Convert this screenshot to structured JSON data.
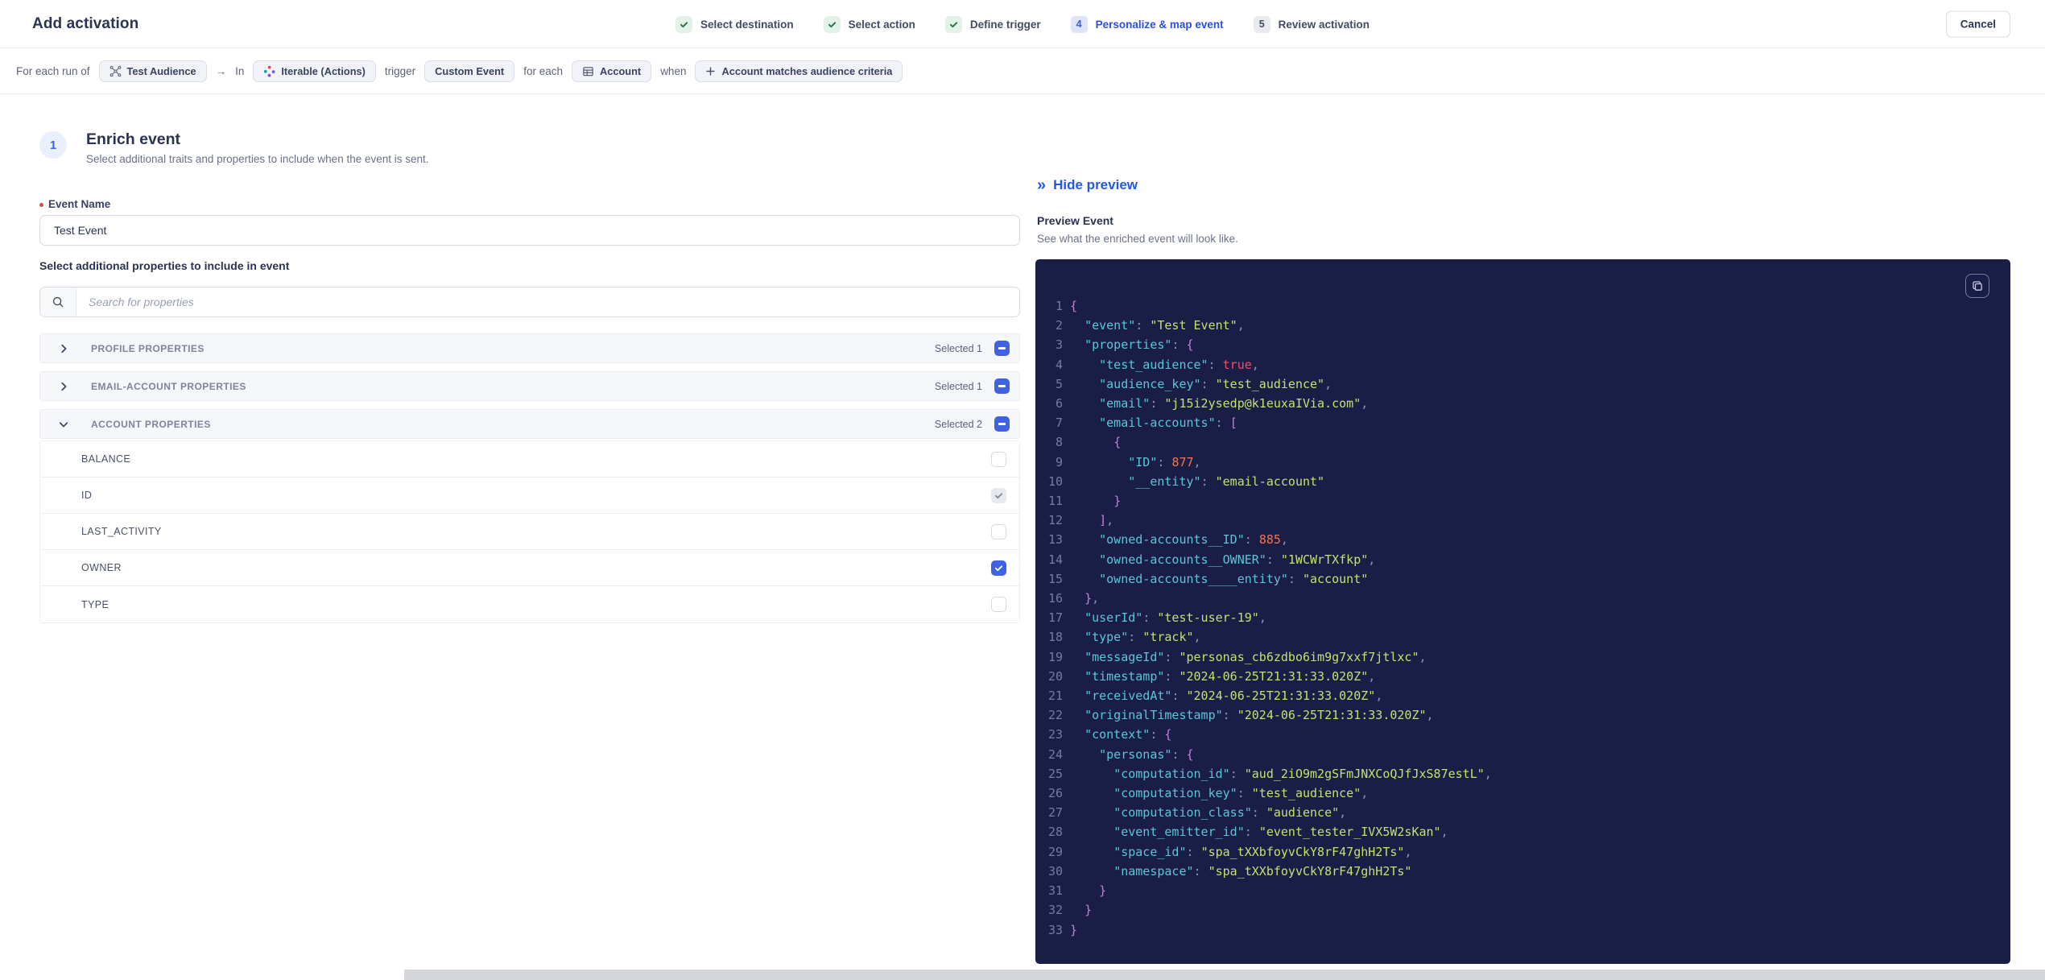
{
  "header": {
    "title": "Add activation",
    "cancel_label": "Cancel",
    "steps": [
      {
        "label": "Select destination",
        "state": "done",
        "badge": "✓"
      },
      {
        "label": "Select action",
        "state": "done",
        "badge": "✓"
      },
      {
        "label": "Define trigger",
        "state": "done",
        "badge": "✓"
      },
      {
        "label": "Personalize & map event",
        "state": "active",
        "badge": "4"
      },
      {
        "label": "Review activation",
        "state": "upcoming",
        "badge": "5"
      }
    ]
  },
  "trigger_bar": {
    "segments": [
      {
        "type": "text",
        "text": "For each run of"
      },
      {
        "type": "pill",
        "icon": "audience",
        "label": "Test Audience"
      },
      {
        "type": "text",
        "text": "→"
      },
      {
        "type": "text",
        "text": "In"
      },
      {
        "type": "pill",
        "icon": "iterable",
        "label": "Iterable (Actions)"
      },
      {
        "type": "text",
        "text": "trigger"
      },
      {
        "type": "pill",
        "label": "Custom Event"
      },
      {
        "type": "text",
        "text": "for each"
      },
      {
        "type": "pill",
        "icon": "table",
        "label": "Account"
      },
      {
        "type": "text",
        "text": "when"
      },
      {
        "type": "pill",
        "icon": "plus",
        "label": "Account matches audience criteria"
      }
    ]
  },
  "enrich": {
    "step_number": "1",
    "title": "Enrich event",
    "subtitle": "Select additional traits and properties to include when the event is sent.",
    "event_name_label": "Event Name",
    "event_name_value": "Test Event",
    "properties_heading": "Select additional properties to include in event",
    "search_placeholder": "Search for properties",
    "groups": [
      {
        "label": "PROFILE PROPERTIES",
        "selected_text": "Selected 1",
        "expanded": false,
        "items": []
      },
      {
        "label": "EMAIL-ACCOUNT PROPERTIES",
        "selected_text": "Selected 1",
        "expanded": false,
        "items": []
      },
      {
        "label": "ACCOUNT PROPERTIES",
        "selected_text": "Selected 2",
        "expanded": true,
        "items": [
          {
            "label": "BALANCE",
            "checkbox": "unchecked"
          },
          {
            "label": "ID",
            "checkbox": "checked-gray"
          },
          {
            "label": "LAST_ACTIVITY",
            "checkbox": "unchecked"
          },
          {
            "label": "OWNER",
            "checkbox": "checked-blue"
          },
          {
            "label": "TYPE",
            "checkbox": "unchecked"
          }
        ]
      }
    ]
  },
  "preview": {
    "hide_label": "Hide preview",
    "title": "Preview Event",
    "subtitle": "See what the enriched event will look like.",
    "code_lines": [
      {
        "n": "1",
        "t": [
          [
            "p",
            "{"
          ]
        ]
      },
      {
        "n": "2",
        "t": [
          [
            "w",
            "  "
          ],
          [
            "k",
            "\"event\""
          ],
          [
            "d",
            ": "
          ],
          [
            "s",
            "\"Test Event\""
          ],
          [
            "d",
            ","
          ]
        ]
      },
      {
        "n": "3",
        "t": [
          [
            "w",
            "  "
          ],
          [
            "k",
            "\"properties\""
          ],
          [
            "d",
            ": "
          ],
          [
            "p",
            "{"
          ]
        ]
      },
      {
        "n": "4",
        "t": [
          [
            "w",
            "    "
          ],
          [
            "k",
            "\"test_audience\""
          ],
          [
            "d",
            ": "
          ],
          [
            "b",
            "true"
          ],
          [
            "d",
            ","
          ]
        ]
      },
      {
        "n": "5",
        "t": [
          [
            "w",
            "    "
          ],
          [
            "k",
            "\"audience_key\""
          ],
          [
            "d",
            ": "
          ],
          [
            "s",
            "\"test_audience\""
          ],
          [
            "d",
            ","
          ]
        ]
      },
      {
        "n": "6",
        "t": [
          [
            "w",
            "    "
          ],
          [
            "k",
            "\"email\""
          ],
          [
            "d",
            ": "
          ],
          [
            "s",
            "\"j15i2ysedp@k1euxaIVia.com\""
          ],
          [
            "d",
            ","
          ]
        ]
      },
      {
        "n": "7",
        "t": [
          [
            "w",
            "    "
          ],
          [
            "k",
            "\"email-accounts\""
          ],
          [
            "d",
            ": "
          ],
          [
            "p",
            "["
          ]
        ]
      },
      {
        "n": "8",
        "t": [
          [
            "w",
            "      "
          ],
          [
            "p",
            "{"
          ]
        ]
      },
      {
        "n": "9",
        "t": [
          [
            "w",
            "        "
          ],
          [
            "k",
            "\"ID\""
          ],
          [
            "d",
            ": "
          ],
          [
            "n",
            "877"
          ],
          [
            "d",
            ","
          ]
        ]
      },
      {
        "n": "10",
        "t": [
          [
            "w",
            "        "
          ],
          [
            "k",
            "\"__entity\""
          ],
          [
            "d",
            ": "
          ],
          [
            "s",
            "\"email-account\""
          ]
        ]
      },
      {
        "n": "11",
        "t": [
          [
            "w",
            "      "
          ],
          [
            "p",
            "}"
          ]
        ]
      },
      {
        "n": "12",
        "t": [
          [
            "w",
            "    "
          ],
          [
            "p",
            "]"
          ],
          [
            "d",
            ","
          ]
        ]
      },
      {
        "n": "13",
        "t": [
          [
            "w",
            "    "
          ],
          [
            "k",
            "\"owned-accounts__ID\""
          ],
          [
            "d",
            ": "
          ],
          [
            "n",
            "885"
          ],
          [
            "d",
            ","
          ]
        ]
      },
      {
        "n": "14",
        "t": [
          [
            "w",
            "    "
          ],
          [
            "k",
            "\"owned-accounts__OWNER\""
          ],
          [
            "d",
            ": "
          ],
          [
            "s",
            "\"1WCWrTXfkp\""
          ],
          [
            "d",
            ","
          ]
        ]
      },
      {
        "n": "15",
        "t": [
          [
            "w",
            "    "
          ],
          [
            "k",
            "\"owned-accounts____entity\""
          ],
          [
            "d",
            ": "
          ],
          [
            "s",
            "\"account\""
          ]
        ]
      },
      {
        "n": "16",
        "t": [
          [
            "w",
            "  "
          ],
          [
            "p",
            "}"
          ],
          [
            "d",
            ","
          ]
        ]
      },
      {
        "n": "17",
        "t": [
          [
            "w",
            "  "
          ],
          [
            "k",
            "\"userId\""
          ],
          [
            "d",
            ": "
          ],
          [
            "s",
            "\"test-user-19\""
          ],
          [
            "d",
            ","
          ]
        ]
      },
      {
        "n": "18",
        "t": [
          [
            "w",
            "  "
          ],
          [
            "k",
            "\"type\""
          ],
          [
            "d",
            ": "
          ],
          [
            "s",
            "\"track\""
          ],
          [
            "d",
            ","
          ]
        ]
      },
      {
        "n": "19",
        "t": [
          [
            "w",
            "  "
          ],
          [
            "k",
            "\"messageId\""
          ],
          [
            "d",
            ": "
          ],
          [
            "s",
            "\"personas_cb6zdbo6im9g7xxf7jtlxc\""
          ],
          [
            "d",
            ","
          ]
        ]
      },
      {
        "n": "20",
        "t": [
          [
            "w",
            "  "
          ],
          [
            "k",
            "\"timestamp\""
          ],
          [
            "d",
            ": "
          ],
          [
            "s",
            "\"2024-06-25T21:31:33.020Z\""
          ],
          [
            "d",
            ","
          ]
        ]
      },
      {
        "n": "21",
        "t": [
          [
            "w",
            "  "
          ],
          [
            "k",
            "\"receivedAt\""
          ],
          [
            "d",
            ": "
          ],
          [
            "s",
            "\"2024-06-25T21:31:33.020Z\""
          ],
          [
            "d",
            ","
          ]
        ]
      },
      {
        "n": "22",
        "t": [
          [
            "w",
            "  "
          ],
          [
            "k",
            "\"originalTimestamp\""
          ],
          [
            "d",
            ": "
          ],
          [
            "s",
            "\"2024-06-25T21:31:33.020Z\""
          ],
          [
            "d",
            ","
          ]
        ]
      },
      {
        "n": "23",
        "t": [
          [
            "w",
            "  "
          ],
          [
            "k",
            "\"context\""
          ],
          [
            "d",
            ": "
          ],
          [
            "p",
            "{"
          ]
        ]
      },
      {
        "n": "24",
        "t": [
          [
            "w",
            "    "
          ],
          [
            "k",
            "\"personas\""
          ],
          [
            "d",
            ": "
          ],
          [
            "p",
            "{"
          ]
        ]
      },
      {
        "n": "25",
        "t": [
          [
            "w",
            "      "
          ],
          [
            "k",
            "\"computation_id\""
          ],
          [
            "d",
            ": "
          ],
          [
            "s",
            "\"aud_2iO9m2gSFmJNXCoQJfJxS87estL\""
          ],
          [
            "d",
            ","
          ]
        ]
      },
      {
        "n": "26",
        "t": [
          [
            "w",
            "      "
          ],
          [
            "k",
            "\"computation_key\""
          ],
          [
            "d",
            ": "
          ],
          [
            "s",
            "\"test_audience\""
          ],
          [
            "d",
            ","
          ]
        ]
      },
      {
        "n": "27",
        "t": [
          [
            "w",
            "      "
          ],
          [
            "k",
            "\"computation_class\""
          ],
          [
            "d",
            ": "
          ],
          [
            "s",
            "\"audience\""
          ],
          [
            "d",
            ","
          ]
        ]
      },
      {
        "n": "28",
        "t": [
          [
            "w",
            "      "
          ],
          [
            "k",
            "\"event_emitter_id\""
          ],
          [
            "d",
            ": "
          ],
          [
            "s",
            "\"event_tester_IVX5W2sKan\""
          ],
          [
            "d",
            ","
          ]
        ]
      },
      {
        "n": "29",
        "t": [
          [
            "w",
            "      "
          ],
          [
            "k",
            "\"space_id\""
          ],
          [
            "d",
            ": "
          ],
          [
            "s",
            "\"spa_tXXbfoyvCkY8rF47ghH2Ts\""
          ],
          [
            "d",
            ","
          ]
        ]
      },
      {
        "n": "30",
        "t": [
          [
            "w",
            "      "
          ],
          [
            "k",
            "\"namespace\""
          ],
          [
            "d",
            ": "
          ],
          [
            "s",
            "\"spa_tXXbfoyvCkY8rF47ghH2Ts\""
          ]
        ]
      },
      {
        "n": "31",
        "t": [
          [
            "w",
            "    "
          ],
          [
            "p",
            "}"
          ]
        ]
      },
      {
        "n": "32",
        "t": [
          [
            "w",
            "  "
          ],
          [
            "p",
            "}"
          ]
        ]
      },
      {
        "n": "33",
        "t": [
          [
            "p",
            "}"
          ]
        ]
      }
    ]
  },
  "colors": {
    "accent_blue": "#2b50e2",
    "checkbox_blue": "#3f62e4",
    "success_green": "#177245",
    "code_bg": "#1a1e46",
    "code_key": "#5ac6d6",
    "code_string": "#c6e06d",
    "code_number": "#f3764f",
    "code_boolean": "#f44d6e",
    "code_punct": "#c77fdd"
  }
}
